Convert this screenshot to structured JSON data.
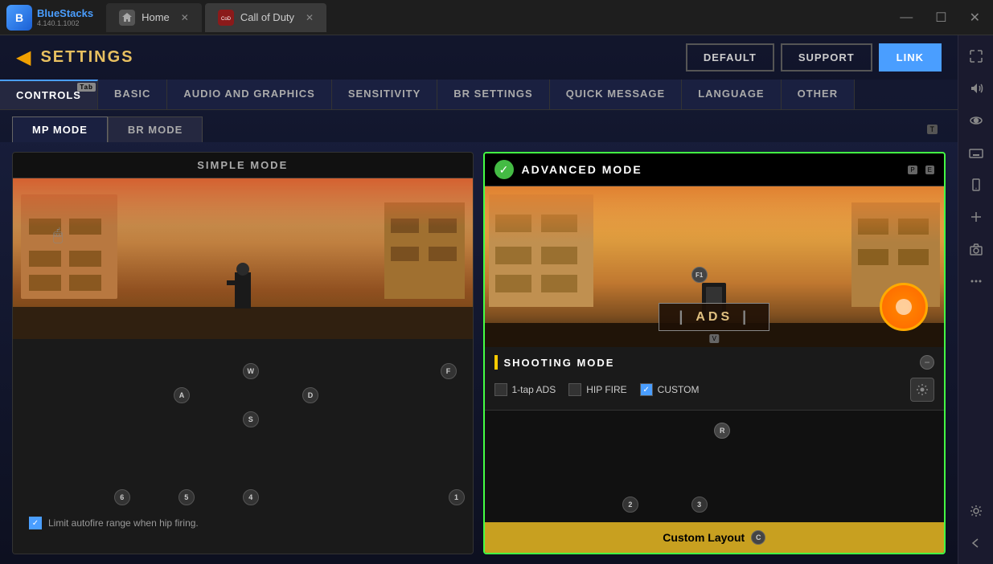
{
  "app": {
    "name": "BlueStacks",
    "version": "4.140.1.1002",
    "logo_letter": "B"
  },
  "titlebar": {
    "home_tab": "Home",
    "game_tab": "Call of Duty",
    "minimize_icon": "—",
    "maximize_icon": "☐",
    "close_icon": "✕"
  },
  "settings": {
    "title": "SETTINGS",
    "back_arrow": "◀",
    "default_btn": "DEFAULT",
    "support_btn": "SUPPORT",
    "link_btn": "LINK"
  },
  "nav_tabs": [
    {
      "label": "CONTROLS",
      "active": true,
      "badge": "Tab"
    },
    {
      "label": "BASIC",
      "active": false
    },
    {
      "label": "AUDIO AND GRAPHICS",
      "active": false
    },
    {
      "label": "SENSITIVITY",
      "active": false
    },
    {
      "label": "BR SETTINGS",
      "active": false
    },
    {
      "label": "QUICK MESSAGE",
      "active": false
    },
    {
      "label": "LANGUAGE",
      "active": false
    },
    {
      "label": "OTHER",
      "active": false
    }
  ],
  "mode_tabs": [
    {
      "label": "MP MODE",
      "active": true
    },
    {
      "label": "BR MODE",
      "active": false
    }
  ],
  "simple_panel": {
    "title": "SIMPLE MODE",
    "checkbox_label": "Limit autofire range when hip firing.",
    "keys": [
      "W",
      "A",
      "D",
      "S",
      "F",
      "6",
      "5",
      "4",
      "1"
    ]
  },
  "advanced_panel": {
    "title": "ADVANCED MODE",
    "check_icon": "✓",
    "p_badge": "P",
    "e_badge": "E",
    "ads_label": "ADS",
    "v_badge": "V",
    "f1_badge": "F1",
    "minus_sign": "−",
    "shooting_mode": {
      "title": "SHOOTING MODE",
      "option1_label": "1-tap ADS",
      "option2_label": "HIP FIRE",
      "option3_label": "CUSTOM",
      "option3_checked": true
    },
    "custom_layout_btn": "Custom Layout",
    "c_badge": "C",
    "r_badge": "R",
    "key_badges": [
      "2",
      "3"
    ]
  },
  "sidebar_icons": {
    "expand": "⤢",
    "volume": "🔊",
    "eye": "👁",
    "keyboard": "⌨",
    "phone": "📱",
    "add": "➕",
    "camera": "📷",
    "more": "⋯",
    "settings": "⚙",
    "back": "←"
  }
}
